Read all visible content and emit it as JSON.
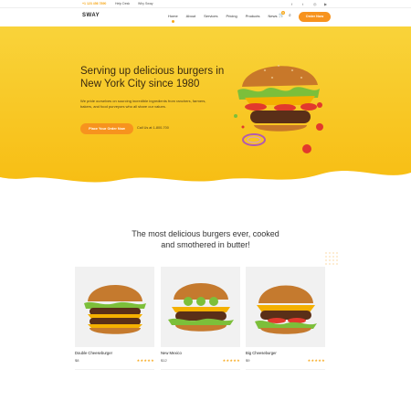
{
  "topbar": {
    "phone": "+1 123 456 7890",
    "link_help": "Help Desk",
    "link_why": "Why Sway",
    "social_icons": [
      "facebook-icon",
      "twitter-icon",
      "instagram-icon",
      "youtube-icon"
    ]
  },
  "header": {
    "logo": "SWAY",
    "nav": [
      "Home",
      "About",
      "Services",
      "Pricing",
      "Products",
      "News"
    ],
    "cart_count": "0",
    "order_button": "Order Now"
  },
  "hero": {
    "title": "Serving up delicious burgers in New York City since 1980",
    "text": "We pride ourselves on sourcing incredible ingredients from ranchers, farmers, bakers, and food purveyors who all share our values.",
    "cta": "Place Your Order Now",
    "call": "Call Us at 1-800-700",
    "colors": {
      "accent": "#f7931e",
      "hero_yellow": "#f8c418"
    }
  },
  "section": {
    "title_line1": "The most delicious burgers ever, cooked",
    "title_line2": "and smothered in butter!"
  },
  "products": [
    {
      "name": "Double Cheeseburger",
      "price": "$8",
      "stars": "★★★★★"
    },
    {
      "name": "New Mexico",
      "price": "$12",
      "stars": "★★★★★"
    },
    {
      "name": "Big Cheeseburger",
      "price": "$9",
      "stars": "★★★★★"
    }
  ]
}
